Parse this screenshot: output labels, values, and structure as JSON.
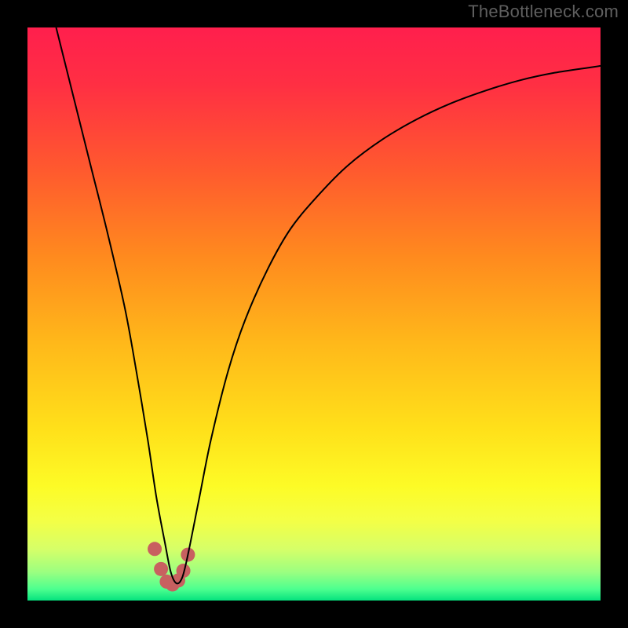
{
  "watermark": "TheBottleneck.com",
  "chart_data": {
    "type": "line",
    "title": "",
    "xlabel": "",
    "ylabel": "",
    "xlim": [
      0,
      100
    ],
    "ylim": [
      0,
      100
    ],
    "grid": false,
    "legend": false,
    "background_gradient": {
      "stops": [
        {
          "pos": 0.0,
          "color": "#ff1f4d"
        },
        {
          "pos": 0.1,
          "color": "#ff2f43"
        },
        {
          "pos": 0.25,
          "color": "#ff5a2e"
        },
        {
          "pos": 0.4,
          "color": "#ff8a1e"
        },
        {
          "pos": 0.55,
          "color": "#ffb81a"
        },
        {
          "pos": 0.7,
          "color": "#ffe01a"
        },
        {
          "pos": 0.8,
          "color": "#fdfb26"
        },
        {
          "pos": 0.86,
          "color": "#f4ff45"
        },
        {
          "pos": 0.91,
          "color": "#d6ff68"
        },
        {
          "pos": 0.95,
          "color": "#9cff80"
        },
        {
          "pos": 0.98,
          "color": "#4dff8f"
        },
        {
          "pos": 1.0,
          "color": "#05e27e"
        }
      ]
    },
    "series": [
      {
        "name": "bottleneck-curve",
        "color": "#000000",
        "width": 2,
        "x": [
          5,
          8,
          11,
          14,
          17,
          19,
          21,
          22.5,
          24,
          25,
          26,
          27,
          28,
          30,
          32,
          35,
          38,
          42,
          46,
          51,
          56,
          62,
          68,
          74,
          80,
          86,
          92,
          98,
          100
        ],
        "y": [
          100,
          88,
          76,
          64,
          51,
          40,
          28,
          18,
          10,
          5,
          3,
          4,
          8,
          18,
          28,
          40,
          49,
          58,
          65,
          71,
          76,
          80.5,
          84,
          86.8,
          89,
          90.8,
          92.1,
          93,
          93.3
        ]
      }
    ],
    "highlight": {
      "name": "trough-marker",
      "color": "#c86060",
      "points_x": [
        22.2,
        23.3,
        24.3,
        25.3,
        26.3,
        27.2,
        28.0
      ],
      "points_y": [
        9,
        5.5,
        3.3,
        2.8,
        3.5,
        5.2,
        8
      ],
      "radius": 9
    }
  }
}
